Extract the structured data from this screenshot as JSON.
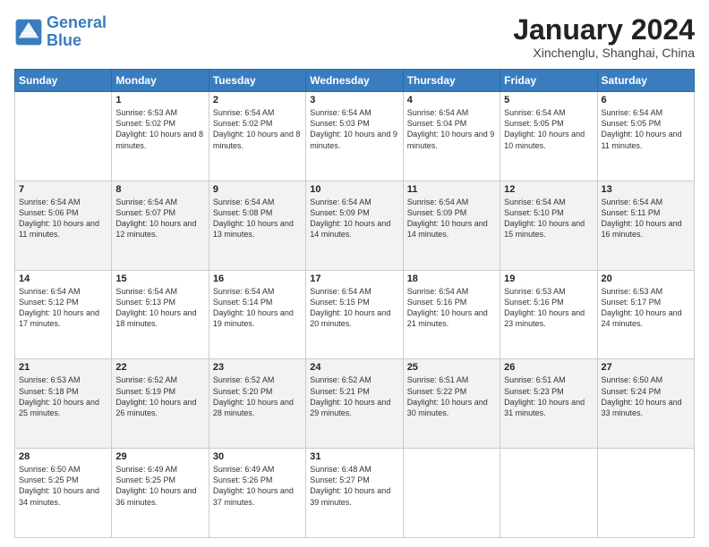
{
  "header": {
    "logo_line1": "General",
    "logo_line2": "Blue",
    "title": "January 2024",
    "subtitle": "Xinchenglu, Shanghai, China"
  },
  "days_of_week": [
    "Sunday",
    "Monday",
    "Tuesday",
    "Wednesday",
    "Thursday",
    "Friday",
    "Saturday"
  ],
  "weeks": [
    [
      {
        "day": "",
        "sunrise": "",
        "sunset": "",
        "daylight": ""
      },
      {
        "day": "1",
        "sunrise": "Sunrise: 6:53 AM",
        "sunset": "Sunset: 5:02 PM",
        "daylight": "Daylight: 10 hours and 8 minutes."
      },
      {
        "day": "2",
        "sunrise": "Sunrise: 6:54 AM",
        "sunset": "Sunset: 5:02 PM",
        "daylight": "Daylight: 10 hours and 8 minutes."
      },
      {
        "day": "3",
        "sunrise": "Sunrise: 6:54 AM",
        "sunset": "Sunset: 5:03 PM",
        "daylight": "Daylight: 10 hours and 9 minutes."
      },
      {
        "day": "4",
        "sunrise": "Sunrise: 6:54 AM",
        "sunset": "Sunset: 5:04 PM",
        "daylight": "Daylight: 10 hours and 9 minutes."
      },
      {
        "day": "5",
        "sunrise": "Sunrise: 6:54 AM",
        "sunset": "Sunset: 5:05 PM",
        "daylight": "Daylight: 10 hours and 10 minutes."
      },
      {
        "day": "6",
        "sunrise": "Sunrise: 6:54 AM",
        "sunset": "Sunset: 5:05 PM",
        "daylight": "Daylight: 10 hours and 11 minutes."
      }
    ],
    [
      {
        "day": "7",
        "sunrise": "Sunrise: 6:54 AM",
        "sunset": "Sunset: 5:06 PM",
        "daylight": "Daylight: 10 hours and 11 minutes."
      },
      {
        "day": "8",
        "sunrise": "Sunrise: 6:54 AM",
        "sunset": "Sunset: 5:07 PM",
        "daylight": "Daylight: 10 hours and 12 minutes."
      },
      {
        "day": "9",
        "sunrise": "Sunrise: 6:54 AM",
        "sunset": "Sunset: 5:08 PM",
        "daylight": "Daylight: 10 hours and 13 minutes."
      },
      {
        "day": "10",
        "sunrise": "Sunrise: 6:54 AM",
        "sunset": "Sunset: 5:09 PM",
        "daylight": "Daylight: 10 hours and 14 minutes."
      },
      {
        "day": "11",
        "sunrise": "Sunrise: 6:54 AM",
        "sunset": "Sunset: 5:09 PM",
        "daylight": "Daylight: 10 hours and 14 minutes."
      },
      {
        "day": "12",
        "sunrise": "Sunrise: 6:54 AM",
        "sunset": "Sunset: 5:10 PM",
        "daylight": "Daylight: 10 hours and 15 minutes."
      },
      {
        "day": "13",
        "sunrise": "Sunrise: 6:54 AM",
        "sunset": "Sunset: 5:11 PM",
        "daylight": "Daylight: 10 hours and 16 minutes."
      }
    ],
    [
      {
        "day": "14",
        "sunrise": "Sunrise: 6:54 AM",
        "sunset": "Sunset: 5:12 PM",
        "daylight": "Daylight: 10 hours and 17 minutes."
      },
      {
        "day": "15",
        "sunrise": "Sunrise: 6:54 AM",
        "sunset": "Sunset: 5:13 PM",
        "daylight": "Daylight: 10 hours and 18 minutes."
      },
      {
        "day": "16",
        "sunrise": "Sunrise: 6:54 AM",
        "sunset": "Sunset: 5:14 PM",
        "daylight": "Daylight: 10 hours and 19 minutes."
      },
      {
        "day": "17",
        "sunrise": "Sunrise: 6:54 AM",
        "sunset": "Sunset: 5:15 PM",
        "daylight": "Daylight: 10 hours and 20 minutes."
      },
      {
        "day": "18",
        "sunrise": "Sunrise: 6:54 AM",
        "sunset": "Sunset: 5:16 PM",
        "daylight": "Daylight: 10 hours and 21 minutes."
      },
      {
        "day": "19",
        "sunrise": "Sunrise: 6:53 AM",
        "sunset": "Sunset: 5:16 PM",
        "daylight": "Daylight: 10 hours and 23 minutes."
      },
      {
        "day": "20",
        "sunrise": "Sunrise: 6:53 AM",
        "sunset": "Sunset: 5:17 PM",
        "daylight": "Daylight: 10 hours and 24 minutes."
      }
    ],
    [
      {
        "day": "21",
        "sunrise": "Sunrise: 6:53 AM",
        "sunset": "Sunset: 5:18 PM",
        "daylight": "Daylight: 10 hours and 25 minutes."
      },
      {
        "day": "22",
        "sunrise": "Sunrise: 6:52 AM",
        "sunset": "Sunset: 5:19 PM",
        "daylight": "Daylight: 10 hours and 26 minutes."
      },
      {
        "day": "23",
        "sunrise": "Sunrise: 6:52 AM",
        "sunset": "Sunset: 5:20 PM",
        "daylight": "Daylight: 10 hours and 28 minutes."
      },
      {
        "day": "24",
        "sunrise": "Sunrise: 6:52 AM",
        "sunset": "Sunset: 5:21 PM",
        "daylight": "Daylight: 10 hours and 29 minutes."
      },
      {
        "day": "25",
        "sunrise": "Sunrise: 6:51 AM",
        "sunset": "Sunset: 5:22 PM",
        "daylight": "Daylight: 10 hours and 30 minutes."
      },
      {
        "day": "26",
        "sunrise": "Sunrise: 6:51 AM",
        "sunset": "Sunset: 5:23 PM",
        "daylight": "Daylight: 10 hours and 31 minutes."
      },
      {
        "day": "27",
        "sunrise": "Sunrise: 6:50 AM",
        "sunset": "Sunset: 5:24 PM",
        "daylight": "Daylight: 10 hours and 33 minutes."
      }
    ],
    [
      {
        "day": "28",
        "sunrise": "Sunrise: 6:50 AM",
        "sunset": "Sunset: 5:25 PM",
        "daylight": "Daylight: 10 hours and 34 minutes."
      },
      {
        "day": "29",
        "sunrise": "Sunrise: 6:49 AM",
        "sunset": "Sunset: 5:25 PM",
        "daylight": "Daylight: 10 hours and 36 minutes."
      },
      {
        "day": "30",
        "sunrise": "Sunrise: 6:49 AM",
        "sunset": "Sunset: 5:26 PM",
        "daylight": "Daylight: 10 hours and 37 minutes."
      },
      {
        "day": "31",
        "sunrise": "Sunrise: 6:48 AM",
        "sunset": "Sunset: 5:27 PM",
        "daylight": "Daylight: 10 hours and 39 minutes."
      },
      {
        "day": "",
        "sunrise": "",
        "sunset": "",
        "daylight": ""
      },
      {
        "day": "",
        "sunrise": "",
        "sunset": "",
        "daylight": ""
      },
      {
        "day": "",
        "sunrise": "",
        "sunset": "",
        "daylight": ""
      }
    ]
  ]
}
